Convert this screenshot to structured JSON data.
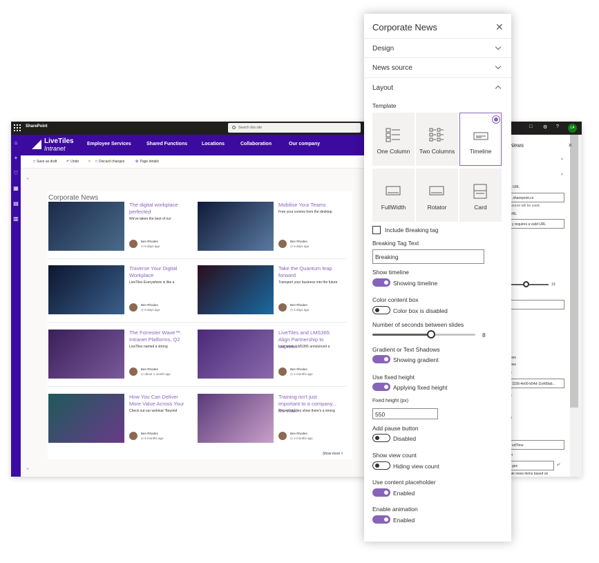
{
  "suite_bar": {
    "app_name": "SharePoint",
    "search_placeholder": "Search this site",
    "avatar_initials": "LA"
  },
  "hub_nav": {
    "logo_line1": "LiveTiles",
    "logo_line2": "Intranet",
    "links": [
      "Employee Services",
      "Shared Functions",
      "Locations",
      "Collaboration",
      "Our company"
    ]
  },
  "command_bar": {
    "save_draft": "Save as draft",
    "undo": "Undo",
    "discard": "Discard changes",
    "page_details": "Page details"
  },
  "webpart": {
    "title": "Corporate News",
    "show_more": "Show more",
    "items": [
      {
        "title": "The digital workplace perfected",
        "excerpt": "We've taken the best of our",
        "author": "Ben Rhodes",
        "meta": "6 days ago",
        "thumb_colors": [
          "#1b2a4a",
          "#4a6b8a"
        ]
      },
      {
        "title": "Mobilise Your Teams",
        "excerpt": "Free your comms from the desktop",
        "author": "Ben Rhodes",
        "meta": "6 days ago",
        "thumb_colors": [
          "#101a3a",
          "#5a7aa0"
        ]
      },
      {
        "title": "Traverse Your Digital Workplace",
        "excerpt": "LiveTiles Everywhere is like a",
        "author": "Ben Rhodes",
        "meta": "6 days ago",
        "thumb_colors": [
          "#0d1630",
          "#3a5f8a"
        ]
      },
      {
        "title": "Take the Quantum leap forward",
        "excerpt": "Transport your business into the future",
        "author": "Ben Rhodes",
        "meta": "6 days ago",
        "thumb_colors": [
          "#2a0d1f",
          "#1a6aa0"
        ]
      },
      {
        "title": "The Forrester Wave™: Intranet Platforms, Q2",
        "excerpt": "LiveTiles named a strong",
        "author": "Ben Rhodes",
        "meta": "about 1 month ago",
        "thumb_colors": [
          "#3a1f5a",
          "#7a5a9a"
        ]
      },
      {
        "title": "LiveTiles and LMS365 Align Partnership to Improve",
        "excerpt": "Last week, LMS365 announced a",
        "author": "Ben Rhodes",
        "meta": "4 months ago",
        "thumb_colors": [
          "#4a2a7a",
          "#8a6aaa"
        ]
      },
      {
        "title": "How You Can Deliver More Value Across Your",
        "excerpt": "Check out our webinar 'Beyond",
        "author": "Ben Rhodes",
        "meta": "6 months ago",
        "thumb_colors": [
          "#1e5a5a",
          "#6a3a8a"
        ]
      },
      {
        "title": "Training isn't just important to a company... it's vital.",
        "excerpt": "Recent studies show there's a strong",
        "author": "Ben Rhodes",
        "meta": "4 months ago",
        "thumb_colors": [
          "#5a3a7a",
          "#c8a0c8"
        ]
      }
    ]
  },
  "edit_pane_behind": {
    "title": "News",
    "snippets": [
      "s URL",
      ".sharepoint.co",
      "source will be used.",
      "URL",
      "y requires a valid URL",
      "13",
      "ews",
      "ews",
      "e",
      "1156-4e00-b54d-11efd9ab...",
      "e",
      "p",
      "edTime",
      "er",
      "ges",
      "ate news items based on"
    ]
  },
  "property_pane": {
    "title": "Corporate News",
    "sections": {
      "design": "Design",
      "news_source": "News source",
      "layout": "Layout"
    },
    "template_label": "Template",
    "templates": [
      {
        "name": "One Column",
        "selected": false
      },
      {
        "name": "Two Columns",
        "selected": false
      },
      {
        "name": "Timeline",
        "selected": true
      },
      {
        "name": "FullWidth",
        "selected": false
      },
      {
        "name": "Rotator",
        "selected": false
      },
      {
        "name": "Card",
        "selected": false
      }
    ],
    "include_breaking_tag": "Include Breaking tag",
    "breaking_tag_text_label": "Breaking Tag Text",
    "breaking_tag_text_value": "Breaking",
    "show_timeline": {
      "label": "Show timeline",
      "state": "Showing timeline",
      "on": true
    },
    "color_content_box": {
      "label": "Color content box",
      "state": "Color box is disabled",
      "on": false
    },
    "seconds_label": "Number of seconds between slides",
    "seconds_value": 8,
    "seconds_max": 14,
    "gradient": {
      "label": "Gradient or Text Shadows",
      "state": "Showing gradient",
      "on": true
    },
    "fixed_height": {
      "label": "Use fixed height",
      "state": "Applying fixed height",
      "on": true
    },
    "fixed_height_px_label": "Fixed height (px)",
    "fixed_height_px_value": "550",
    "pause_button": {
      "label": "Add pause button",
      "state": "Disabled",
      "on": false
    },
    "view_count": {
      "label": "Show view count",
      "state": "Hiding view count",
      "on": false
    },
    "content_placeholder": {
      "label": "Use content placeholder",
      "state": "Enabled",
      "on": true
    },
    "animation": {
      "label": "Enable animation",
      "state": "Enabled",
      "on": true
    }
  },
  "colors": {
    "accent": "#8764b8",
    "hub_nav": "#3c0a9e",
    "suite_bar": "#201f1e"
  }
}
